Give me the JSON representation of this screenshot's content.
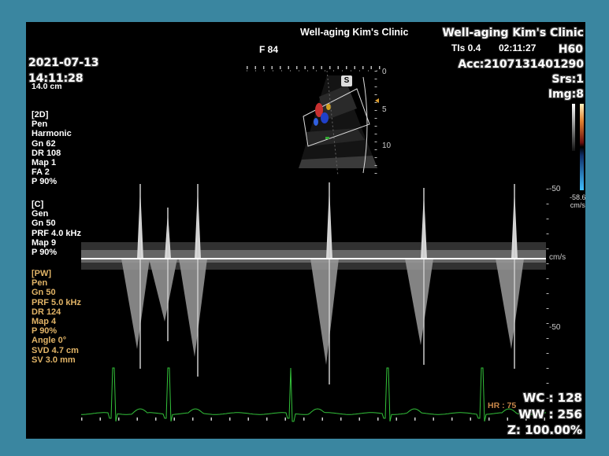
{
  "header": {
    "clinic_name": "Well-aging Kim's Clinic",
    "frequency": "F 84",
    "tis": "TIs  0.4",
    "time": "02:11:27"
  },
  "overlay": {
    "clinic_name": "Well-aging Kim's Clinic",
    "probe": "H60",
    "accession": "Acc:2107131401290",
    "series": "Srs:1",
    "image": "Img:8",
    "date": "2021-07-13",
    "time": "14:11:28",
    "depth": "14.0 cm",
    "wc": "WC : 128",
    "ww": "WW : 256",
    "zoom": "Z: 100.00%"
  },
  "params_2d": [
    "[2D]",
    "Pen",
    "Harmonic",
    "Gn  62",
    "DR  108",
    "Map 1",
    "FA  2",
    "P    90%"
  ],
  "params_color": [
    "[C]",
    "Gen",
    "Gn  50",
    "PRF 4.0 kHz",
    "Map 9",
    "P    90%"
  ],
  "params_pw": [
    "[PW]",
    "Pen",
    "Gn  50",
    "PRF 5.0 kHz",
    "DR  124",
    "Map 4",
    "P    90%",
    "Angle 0°",
    "SVD 4.7 cm",
    "SV  3.0 mm"
  ],
  "image_depth_scale": [
    "0",
    "5",
    "10"
  ],
  "colorbar": {
    "value": "-58.6",
    "unit": "cm/s"
  },
  "doppler_scale": {
    "top": "-50",
    "baseline": "cm/s",
    "bottom": "-50"
  },
  "heart_rate": "HR : 75",
  "sample_volume_marker": "S",
  "colors": {
    "background_frame": "#3a86a0",
    "screen": "#000000",
    "pw_params": "#e0b366",
    "ecg": "#33c23a",
    "hr": "#c8874a"
  }
}
